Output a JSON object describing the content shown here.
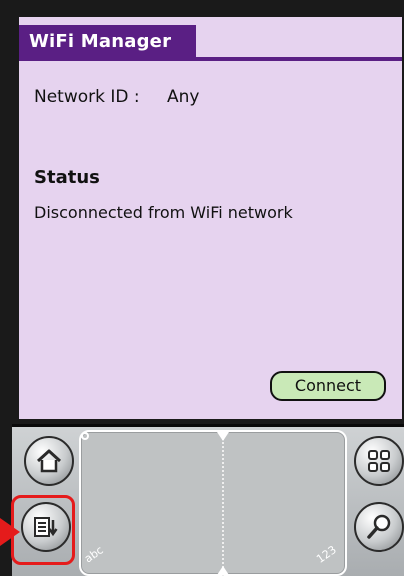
{
  "app": {
    "title": "WiFi Manager"
  },
  "network": {
    "label": "Network ID :",
    "value": "Any"
  },
  "status": {
    "heading": "Status",
    "text": "Disconnected from WiFi network"
  },
  "actions": {
    "connect_label": "Connect"
  },
  "graffiti": {
    "abc_mark": "abc",
    "num_mark": "123"
  },
  "icons": {
    "home": "home-icon",
    "menu": "menu-icon",
    "applications": "grid-icon",
    "find": "magnifier-icon"
  },
  "colors": {
    "screen_bg": "#e6d3ef",
    "title_bar": "#5a1f84",
    "connect_button": "#c9e9b7",
    "highlight": "#e51b1b"
  }
}
